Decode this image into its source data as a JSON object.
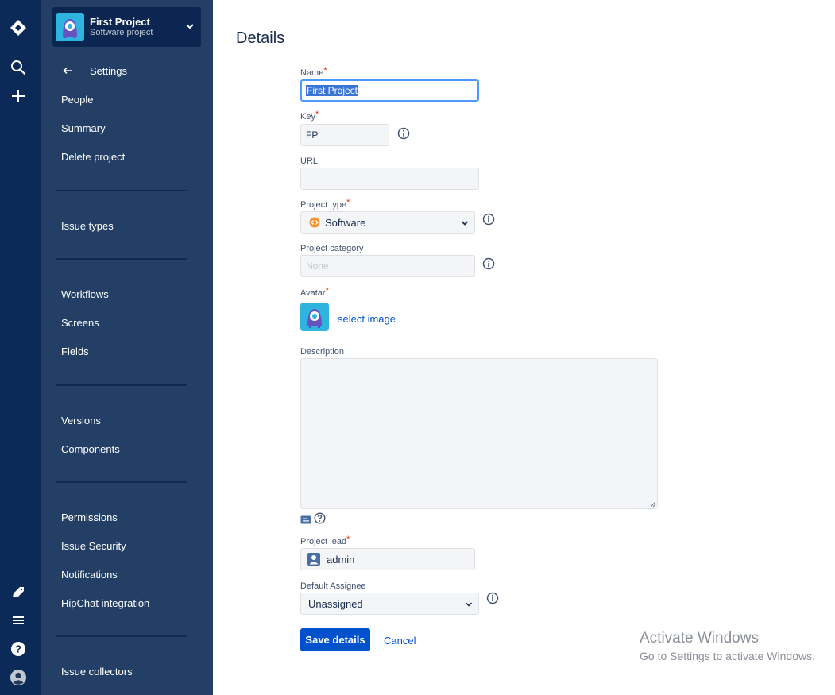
{
  "sidebar": {
    "project_name": "First Project",
    "project_type": "Software project",
    "back_label": "Settings",
    "items": [
      {
        "label": "People"
      },
      {
        "label": "Summary"
      },
      {
        "label": "Delete project"
      },
      {
        "label": "Issue types"
      },
      {
        "label": "Workflows"
      },
      {
        "label": "Screens"
      },
      {
        "label": "Fields"
      },
      {
        "label": "Versions"
      },
      {
        "label": "Components"
      },
      {
        "label": "Permissions"
      },
      {
        "label": "Issue Security"
      },
      {
        "label": "Notifications"
      },
      {
        "label": "HipChat integration"
      },
      {
        "label": "Issue collectors"
      }
    ]
  },
  "rail": {
    "icons": [
      "jira-logo-icon",
      "search-icon",
      "create-icon",
      "feedback-icon",
      "menu-icon",
      "help-icon",
      "profile-icon"
    ]
  },
  "form": {
    "title": "Details",
    "name_label": "Name",
    "name_value": "First Project",
    "key_label": "Key",
    "key_value": "FP",
    "url_label": "URL",
    "url_value": "",
    "project_type_label": "Project type",
    "project_type_value": "Software",
    "project_category_label": "Project category",
    "project_category_value": "None",
    "avatar_label": "Avatar",
    "select_image_link": "select image",
    "description_label": "Description",
    "description_value": "",
    "project_lead_label": "Project lead",
    "project_lead_value": "admin",
    "default_assignee_label": "Default Assignee",
    "default_assignee_value": "Unassigned",
    "save_button": "Save details",
    "cancel_link": "Cancel"
  },
  "watermark": {
    "line1": "Activate Windows",
    "line2": "Go to Settings to activate Windows."
  },
  "colors": {
    "rail_bg": "#0c2a57",
    "sidebar_bg": "#233f66",
    "primary": "#0052cc",
    "required": "#de350b",
    "software_icon": "#f79232",
    "avatar": "#2fb4e0"
  }
}
